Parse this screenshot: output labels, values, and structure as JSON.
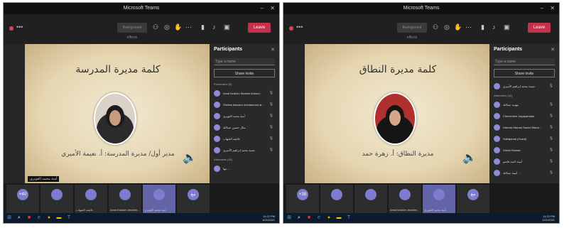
{
  "window_title": "Microsoft Teams",
  "toolbar": {
    "dots": "•••",
    "background_button": "Background effects",
    "leave_label": "Leave"
  },
  "panel": {
    "title": "Participants",
    "search_placeholder": "Type a name",
    "share_invite": "Share invite"
  },
  "left": {
    "slide_title": "كلمة مديرة المدرسة",
    "caption": "مدير أول/ مديرة المدرسة: أ. نعيمة الأميري",
    "presenter_label": "أمنة محمد الغويري",
    "sections": [
      {
        "label": "Presenters (9)",
        "people": [
          "Amal Ibrahim Ibrahim Ahmed...",
          "Shefaa bassam mohammad al...",
          "أمنة محمد الغويري",
          "مثال حسين عبدالله",
          "عائشه الشهاب",
          "نعيمة محمد إبراهيم الأميري"
        ]
      },
      {
        "label": "Attendees (41)",
        "people": [
          "مها ...",
          "..."
        ]
      }
    ],
    "tiles": [
      "+40",
      "",
      "عائشه الشهاب",
      "Amal Ibrahim Ibrahim...",
      "أمنة محمد الغويري",
      "مع"
    ],
    "clock_time": "11:22 PM",
    "clock_date": "1/21/2021"
  },
  "right": {
    "slide_title": "كلمة مديرة النطاق",
    "caption": "مديرة النطاق: أ. زهرة حمد",
    "sections": [
      {
        "label": "",
        "people": [
          "نعيمة محمد إبراهيم الأميري"
        ]
      },
      {
        "label": "Attendees (41)",
        "people": [
          "مهديه عبدالله",
          "Clementine Jayapandian",
          "Hamda Hamad Saeed Moha...",
          "Sabajamal (Guest)",
          "Zahra Hamad",
          "أمينة احمد قاسم",
          "أمينة عبدالله ..."
        ]
      }
    ],
    "tiles": [
      "+38",
      "",
      "",
      "Amal Ibrahim Ibrahim...",
      "أمنة محمد الغويري",
      "مع"
    ],
    "clock_time": "11:22 PM",
    "clock_date": "1/21/2021"
  }
}
